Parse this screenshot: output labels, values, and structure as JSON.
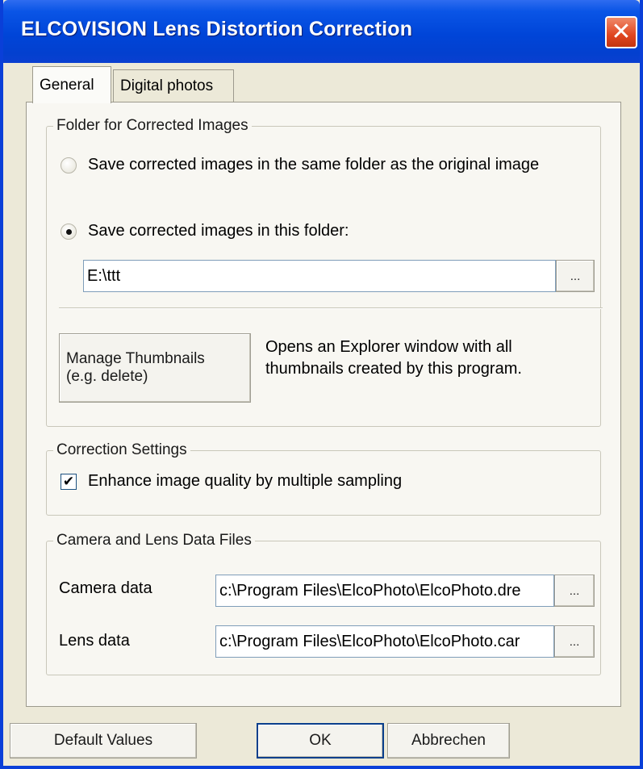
{
  "window": {
    "title": "ELCOVISION Lens Distortion Correction",
    "close_glyph": "✕"
  },
  "tabs": [
    {
      "label": "General",
      "active": true
    },
    {
      "label": "Digital photos",
      "active": false
    }
  ],
  "folder_group": {
    "legend": "Folder for Corrected Images",
    "radio_same_folder": "Save corrected images in the same folder as the original image",
    "radio_this_folder": "Save corrected images in this folder:",
    "selected": "this_folder",
    "folder_value": "E:\\ttt",
    "browse_label": "...",
    "manage_button_line1": "Manage Thumbnails",
    "manage_button_line2": "(e.g. delete)",
    "manage_description_line1": "Opens an Explorer window with all",
    "manage_description_line2": "thumbnails created by this program."
  },
  "correction_group": {
    "legend": "Correction Settings",
    "checkbox_label": "Enhance image quality by multiple sampling",
    "checked": true,
    "check_glyph": "✔"
  },
  "files_group": {
    "legend": "Camera and Lens Data Files",
    "camera_label": "Camera data",
    "camera_value": "c:\\Program Files\\ElcoPhoto\\ElcoPhoto.dre",
    "lens_label": "Lens data",
    "lens_value": "c:\\Program Files\\ElcoPhoto\\ElcoPhoto.car",
    "browse_label": "..."
  },
  "buttons": {
    "default_values": "Default Values",
    "ok": "OK",
    "cancel": "Abbrechen"
  },
  "colors": {
    "titlebar": "#0045d8",
    "face": "#ece9d8",
    "close": "#e0451f"
  }
}
